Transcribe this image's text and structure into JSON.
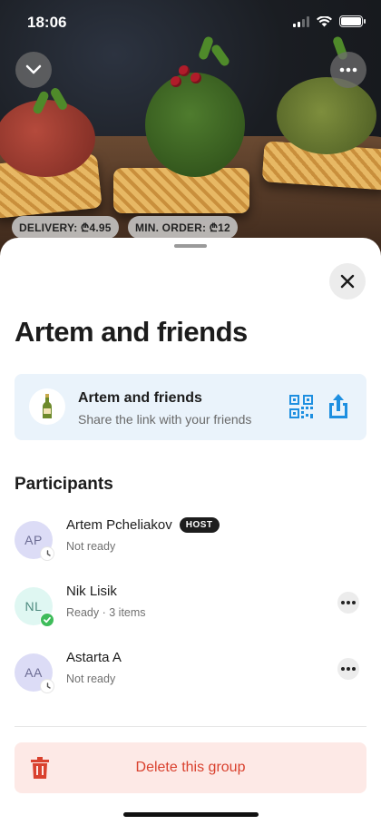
{
  "status_bar": {
    "time": "18:06"
  },
  "hero": {
    "delivery_chip": "DELIVERY: ₾4.95",
    "min_order_chip": "MIN. ORDER: ₾12"
  },
  "sheet": {
    "title": "Artem and friends",
    "share_card": {
      "title": "Artem and friends",
      "subtitle": "Share the link with your friends",
      "icon": "wine-bottle-icon"
    },
    "participants_heading": "Participants",
    "participants": [
      {
        "initials": "AP",
        "name": "Artem Pcheliakov",
        "host_badge": "HOST",
        "status": "Not ready",
        "status_icon": "clock-icon"
      },
      {
        "initials": "NL",
        "name": "Nik Lisik",
        "status": "Ready · 3 items",
        "status_icon": "check-icon"
      },
      {
        "initials": "AA",
        "name": "Astarta A",
        "status": "Not ready",
        "status_icon": "clock-icon"
      }
    ],
    "delete_label": "Delete this group"
  },
  "colors": {
    "share_card_bg": "#eaf3fb",
    "accent_blue": "#1e8fe0",
    "delete_red": "#d9412e",
    "delete_bg": "#fde9e6",
    "ready_green": "#3ebc5a"
  }
}
